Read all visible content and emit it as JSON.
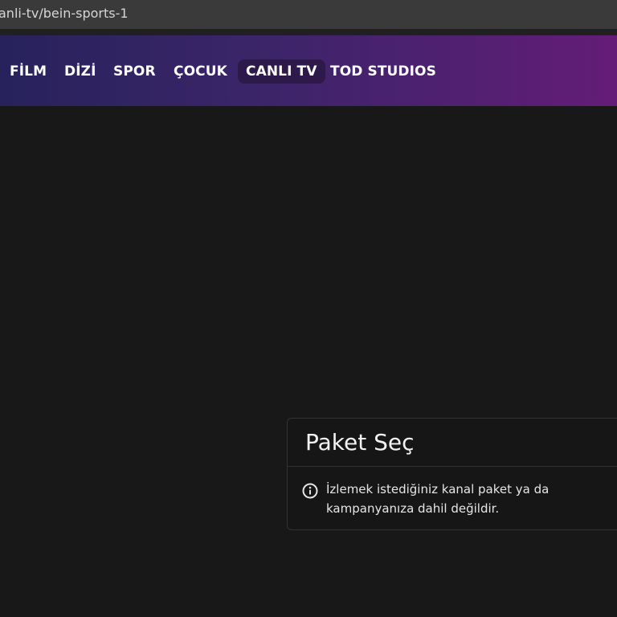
{
  "browser": {
    "url": "anli-tv/bein-sports-1"
  },
  "nav": {
    "items": [
      {
        "label": "FİLM"
      },
      {
        "label": "DİZİ"
      },
      {
        "label": "SPOR"
      },
      {
        "label": "ÇOCUK"
      },
      {
        "label": "CANLI TV",
        "active": true
      },
      {
        "label": "TOD STUDIOS"
      }
    ]
  },
  "modal": {
    "title": "Paket Seç",
    "icon": "info-icon",
    "message": "İzlemek istediğiniz kanal paket ya da kampanyanıza dahil değildir."
  },
  "colors": {
    "nav_gradient_start": "#27225c",
    "nav_gradient_end": "#651c78",
    "background": "#181818",
    "active_tab_bg": "#2d1a4a"
  }
}
